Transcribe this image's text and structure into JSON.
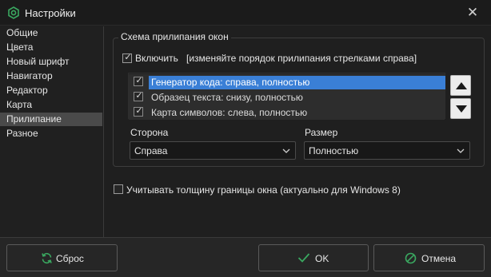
{
  "window": {
    "title": "Настройки",
    "close_glyph": "✕",
    "app_icon": "gear-hexagon-icon",
    "accent": "#3aa860"
  },
  "sidebar": {
    "items": [
      {
        "label": "Общие",
        "selected": false
      },
      {
        "label": "Цвета",
        "selected": false
      },
      {
        "label": "Новый шрифт",
        "selected": false
      },
      {
        "label": "Навигатор",
        "selected": false
      },
      {
        "label": "Редактор",
        "selected": false
      },
      {
        "label": "Карта",
        "selected": false
      },
      {
        "label": "Прилипание",
        "selected": true
      },
      {
        "label": "Разное",
        "selected": false
      }
    ]
  },
  "docking": {
    "group_title": "Схема прилипания окон",
    "enable_label": "Включить",
    "enable_hint": "[изменяйте порядок прилипания стрелками справа]",
    "enable_checked": true,
    "list": [
      {
        "label": "Генератор кода: справа, полностью",
        "checked": true,
        "selected": true
      },
      {
        "label": "Образец текста: снизу, полностью",
        "checked": true,
        "selected": false
      },
      {
        "label": "Карта символов: слева, полностью",
        "checked": true,
        "selected": false
      }
    ],
    "side_label": "Сторона",
    "side_value": "Справа",
    "size_label": "Размер",
    "size_value": "Полностью",
    "selection_color": "#3a7fd6"
  },
  "border_option": {
    "label": "Учитывать толщину границы окна (актуально для Windows 8)",
    "checked": false
  },
  "buttons": {
    "reset": "Сброс",
    "ok": "OK",
    "cancel": "Отмена",
    "icon_color": "#3aa860"
  }
}
